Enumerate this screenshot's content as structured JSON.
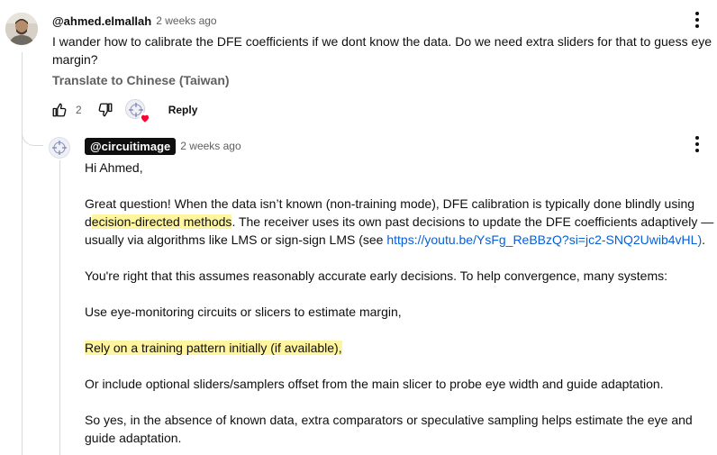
{
  "comment": {
    "author": "@ahmed.elmallah",
    "time": "2 weeks ago",
    "text": "I wander how to calibrate the DFE coefficients if we dont know the data. Do we need extra sliders for that to guess eye margin?",
    "translate_label": "Translate to Chinese (Taiwan)",
    "like_count": "2",
    "reply_label": "Reply"
  },
  "reply": {
    "author": "@circuitimage",
    "time": "2 weeks ago",
    "greeting": "Hi Ahmed,",
    "p1_a": "Great question! When the data isn’t known (non-training mode), DFE calibration is typically done blindly using d",
    "p1_hl": "ecision-directed methods",
    "p1_b": ". The receiver uses its own past decisions to update the DFE coefficients adaptively — usually via algorithms like LMS or sign-sign LMS (see ",
    "p1_link": "https://youtu.be/YsFg_ReBBzQ?si=jc2-SNQ2Uwib4vHL)",
    "p1_c": ".",
    "p2": "You're right that this assumes reasonably accurate early decisions. To help convergence, many systems:",
    "p3": "Use eye-monitoring circuits or slicers to estimate margin,",
    "p4": " Rely on a training pattern initially (if available),",
    "p5": "Or include optional sliders/samplers offset from the main slicer to probe eye width and guide adaptation.",
    "p6": "So yes, in the absence of known data, extra comparators or speculative sampling helps estimate the eye and guide adaptation."
  },
  "colors": {
    "highlight": "#fff59e",
    "link": "#065fd4",
    "heart": "#ff0033",
    "author_chip": "#0f0f0f"
  },
  "icons": {
    "like": "thumbs-up-icon",
    "dislike": "thumbs-down-icon",
    "menu": "more-vert-icon",
    "heart": "heart-icon"
  }
}
